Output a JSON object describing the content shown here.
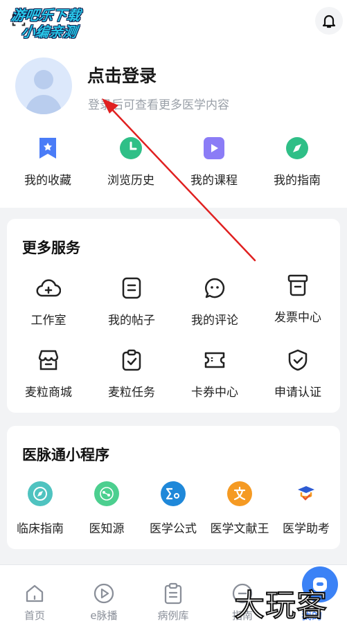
{
  "watermark_top": {
    "line1": "游吧乐下载",
    "line2": "小编亲测"
  },
  "profile": {
    "title": "点击登录",
    "subtitle": "登录后可查看更多医学内容"
  },
  "quick_links": [
    {
      "label": "我的收藏",
      "icon": "bookmark-icon",
      "color": "#4a7cf7"
    },
    {
      "label": "浏览历史",
      "icon": "clock-icon",
      "color": "#2fbf87"
    },
    {
      "label": "我的课程",
      "icon": "play-icon",
      "color": "#8b7cf6"
    },
    {
      "label": "我的指南",
      "icon": "compass-icon",
      "color": "#2fbf87"
    }
  ],
  "services": {
    "title": "更多服务",
    "row1": [
      {
        "label": "工作室",
        "icon": "cloud-plus-icon"
      },
      {
        "label": "我的帖子",
        "icon": "document-icon"
      },
      {
        "label": "我的评论",
        "icon": "comment-icon"
      },
      {
        "label": "发票中心",
        "icon": "invoice-icon"
      }
    ],
    "row2": [
      {
        "label": "麦粒商城",
        "icon": "store-icon"
      },
      {
        "label": "麦粒任务",
        "icon": "task-icon"
      },
      {
        "label": "卡券中心",
        "icon": "ticket-icon"
      },
      {
        "label": "申请认证",
        "icon": "shield-check-icon"
      }
    ]
  },
  "mini_programs": {
    "title": "医脉通小程序",
    "items": [
      {
        "label": "临床指南",
        "icon": "compass-icon",
        "color": "#4fc3c0"
      },
      {
        "label": "医知源",
        "icon": "molecule-icon",
        "color": "#4ccf8f"
      },
      {
        "label": "医学公式",
        "icon": "sigma-icon",
        "color": "#1f88d9"
      },
      {
        "label": "医学文献王",
        "icon": "text-icon",
        "color": "#f59a23"
      },
      {
        "label": "医学助考",
        "icon": "graduation-cap-icon",
        "color": "#e8552c"
      }
    ]
  },
  "tabbar": [
    {
      "label": "首页",
      "icon": "home-icon"
    },
    {
      "label": "e脉播",
      "icon": "play-circle-icon"
    },
    {
      "label": "病例库",
      "icon": "clipboard-icon"
    },
    {
      "label": "指南",
      "icon": "guide-icon"
    },
    {
      "label": "我的",
      "icon": "profile-icon",
      "active": true
    }
  ],
  "watermark_bottom": "大玩客",
  "accent": "#2b6ff6",
  "annotation_color": "#e02020"
}
